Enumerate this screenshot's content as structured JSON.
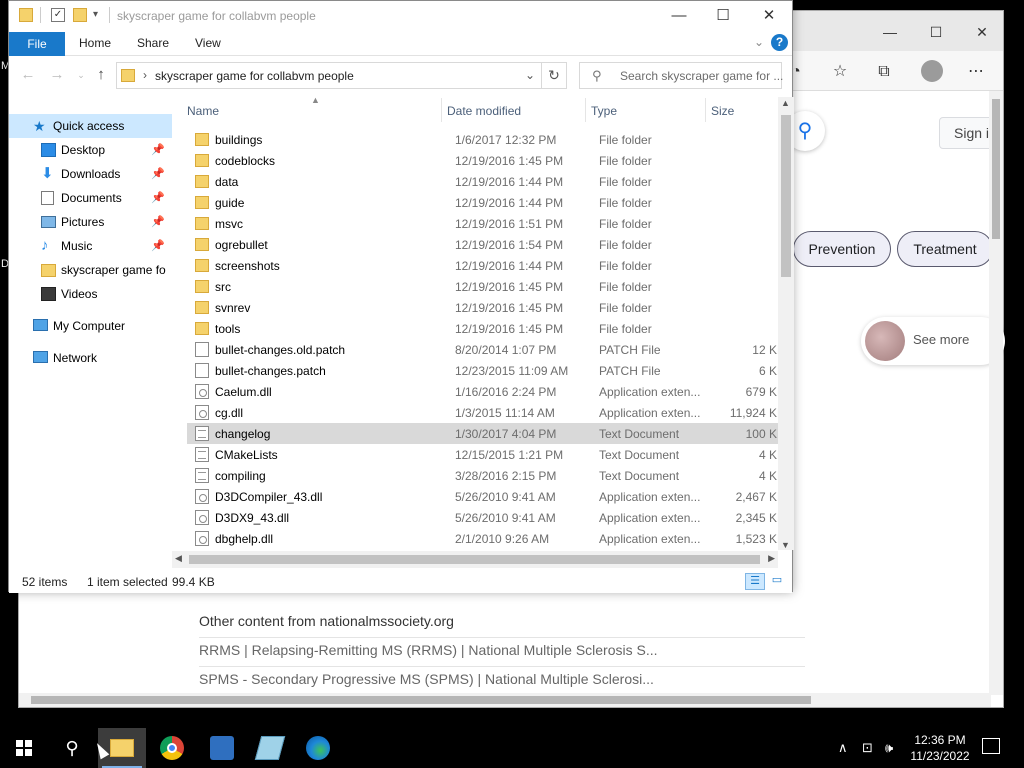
{
  "browser": {
    "sign_in": "Sign i",
    "chips": [
      "Prevention",
      "Treatment"
    ],
    "see_more": "See more",
    "other_heading": "Other content from nationalmssociety.org",
    "other_links": [
      "RRMS | Relapsing-Remitting MS (RRMS) | National Multiple Sclerosis S...",
      "SPMS - Secondary Progressive MS (SPMS) | National Multiple Sclerosi..."
    ],
    "desktop_edge_letters": [
      "M",
      "D"
    ]
  },
  "explorer": {
    "title": "skyscraper game for collabvm people",
    "ribbon": {
      "file": "File",
      "home": "Home",
      "share": "Share",
      "view": "View",
      "help": "?"
    },
    "address": "skyscraper game for collabvm people",
    "search_placeholder": "Search skyscraper game for ...",
    "nav": {
      "quick_access": "Quick access",
      "items": [
        {
          "label": "Desktop",
          "icon": "desktop-icon",
          "pinned": true
        },
        {
          "label": "Downloads",
          "icon": "downloads-icon",
          "pinned": true
        },
        {
          "label": "Documents",
          "icon": "documents-icon",
          "pinned": true
        },
        {
          "label": "Pictures",
          "icon": "pictures-icon",
          "pinned": true
        },
        {
          "label": "Music",
          "icon": "music-icon",
          "pinned": true
        },
        {
          "label": "skyscraper game fo",
          "icon": "folder-icon",
          "pinned": false
        },
        {
          "label": "Videos",
          "icon": "videos-icon",
          "pinned": false
        }
      ],
      "my_computer": "My Computer",
      "network": "Network"
    },
    "columns": {
      "name": "Name",
      "date": "Date modified",
      "type": "Type",
      "size": "Size"
    },
    "files": [
      {
        "name": "buildings",
        "date": "1/6/2017 12:32 PM",
        "type": "File folder",
        "size": "",
        "kind": "folder"
      },
      {
        "name": "codeblocks",
        "date": "12/19/2016 1:45 PM",
        "type": "File folder",
        "size": "",
        "kind": "folder"
      },
      {
        "name": "data",
        "date": "12/19/2016 1:44 PM",
        "type": "File folder",
        "size": "",
        "kind": "folder"
      },
      {
        "name": "guide",
        "date": "12/19/2016 1:44 PM",
        "type": "File folder",
        "size": "",
        "kind": "folder"
      },
      {
        "name": "msvc",
        "date": "12/19/2016 1:51 PM",
        "type": "File folder",
        "size": "",
        "kind": "folder"
      },
      {
        "name": "ogrebullet",
        "date": "12/19/2016 1:54 PM",
        "type": "File folder",
        "size": "",
        "kind": "folder"
      },
      {
        "name": "screenshots",
        "date": "12/19/2016 1:44 PM",
        "type": "File folder",
        "size": "",
        "kind": "folder"
      },
      {
        "name": "src",
        "date": "12/19/2016 1:45 PM",
        "type": "File folder",
        "size": "",
        "kind": "folder"
      },
      {
        "name": "svnrev",
        "date": "12/19/2016 1:45 PM",
        "type": "File folder",
        "size": "",
        "kind": "folder"
      },
      {
        "name": "tools",
        "date": "12/19/2016 1:45 PM",
        "type": "File folder",
        "size": "",
        "kind": "folder"
      },
      {
        "name": "bullet-changes.old.patch",
        "date": "8/20/2014 1:07 PM",
        "type": "PATCH File",
        "size": "12 KB",
        "kind": "file"
      },
      {
        "name": "bullet-changes.patch",
        "date": "12/23/2015 11:09 AM",
        "type": "PATCH File",
        "size": "6 KB",
        "kind": "file"
      },
      {
        "name": "Caelum.dll",
        "date": "1/16/2016 2:24 PM",
        "type": "Application exten...",
        "size": "679 KB",
        "kind": "dll"
      },
      {
        "name": "cg.dll",
        "date": "1/3/2015 11:14 AM",
        "type": "Application exten...",
        "size": "11,924 KB",
        "kind": "dll"
      },
      {
        "name": "changelog",
        "date": "1/30/2017 4:04 PM",
        "type": "Text Document",
        "size": "100 KB",
        "kind": "txt",
        "selected": true
      },
      {
        "name": "CMakeLists",
        "date": "12/15/2015 1:21 PM",
        "type": "Text Document",
        "size": "4 KB",
        "kind": "txt"
      },
      {
        "name": "compiling",
        "date": "3/28/2016 2:15 PM",
        "type": "Text Document",
        "size": "4 KB",
        "kind": "txt"
      },
      {
        "name": "D3DCompiler_43.dll",
        "date": "5/26/2010 9:41 AM",
        "type": "Application exten...",
        "size": "2,467 KB",
        "kind": "dll"
      },
      {
        "name": "D3DX9_43.dll",
        "date": "5/26/2010 9:41 AM",
        "type": "Application exten...",
        "size": "2,345 KB",
        "kind": "dll"
      },
      {
        "name": "dbghelp.dll",
        "date": "2/1/2010 9:26 AM",
        "type": "Application exten...",
        "size": "1,523 KB",
        "kind": "dll"
      }
    ],
    "status": {
      "count": "52 items",
      "selected": "1 item selected",
      "size": "99.4 KB"
    }
  },
  "taskbar": {
    "apps": [
      "file-explorer-icon",
      "chrome-icon",
      "app-icon",
      "notepad-icon",
      "edge-icon"
    ],
    "time": "12:36 PM",
    "date": "11/23/2022"
  }
}
